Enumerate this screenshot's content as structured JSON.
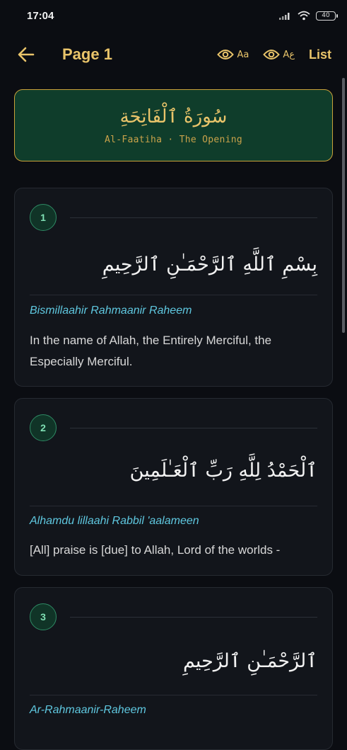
{
  "status": {
    "time": "17:04",
    "battery": "40"
  },
  "app_bar": {
    "title": "Page 1",
    "toggle_text_label": "Aa",
    "toggle_arabic_label": "Aع",
    "list_label": "List",
    "icons": {
      "back": "arrow-left-icon",
      "toggle": "eye-icon"
    },
    "accent_color": "#e9c46a"
  },
  "surah": {
    "arabic_name": "سُورَةُ ٱلْفَاتِحَةِ",
    "subtitle": "Al-Faatiha · The Opening"
  },
  "ayahs": [
    {
      "number": "1",
      "arabic": "بِسْمِ ٱللَّهِ ٱلرَّحْمَـٰنِ ٱلرَّحِيمِ",
      "transliteration": "Bismillaahir Rahmaanir Raheem",
      "translation": "In the name of Allah, the Entirely Merciful, the Especially Merciful."
    },
    {
      "number": "2",
      "arabic": "ٱلْحَمْدُ لِلَّهِ رَبِّ ٱلْعَـٰلَمِينَ",
      "transliteration": "Alhamdu lillaahi Rabbil 'aalameen",
      "translation": "[All] praise is [due] to Allah, Lord of the worlds -"
    },
    {
      "number": "3",
      "arabic": "ٱلرَّحْمَـٰنِ ٱلرَّحِيمِ",
      "transliteration": "Ar-Rahmaanir-Raheem"
    }
  ]
}
